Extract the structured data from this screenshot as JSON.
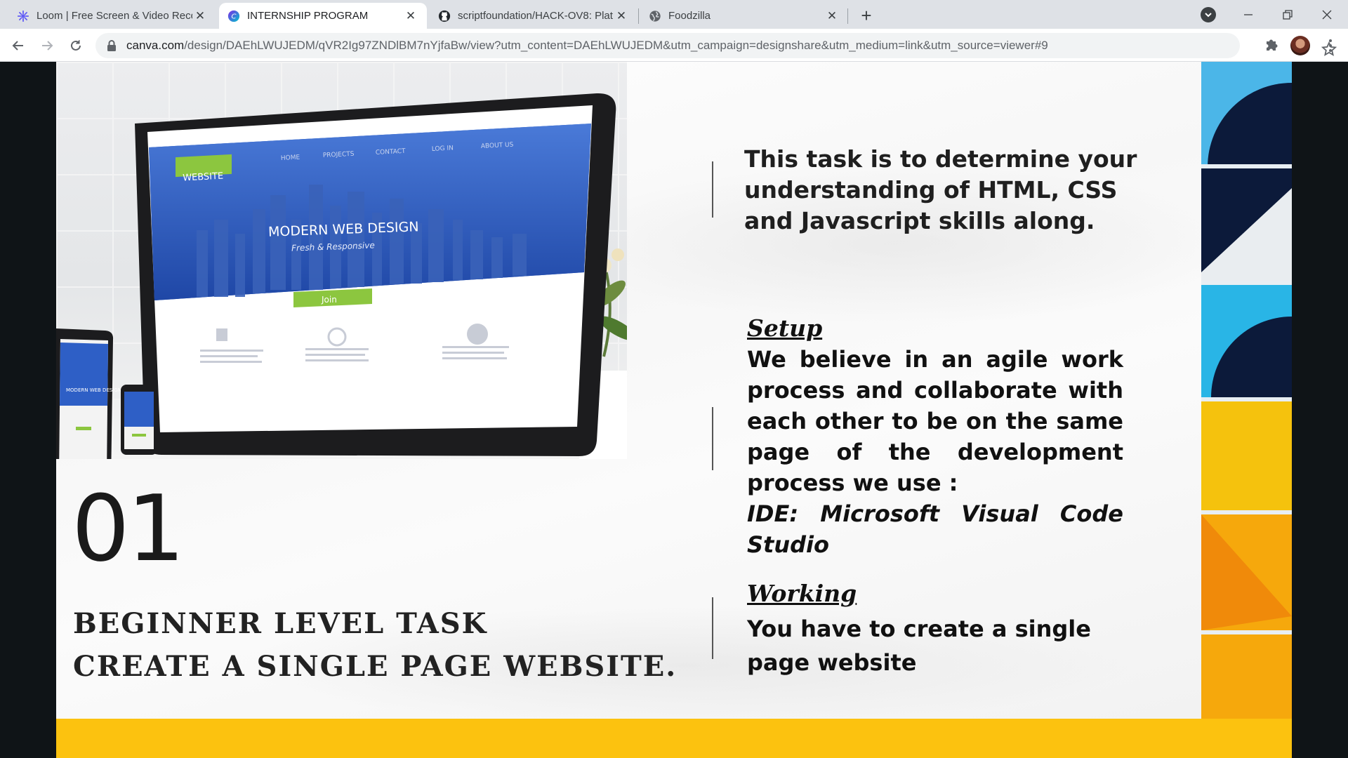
{
  "browser": {
    "tabs": [
      {
        "title": "Loom | Free Screen & Video Reco",
        "icon": "loom-icon",
        "active": false
      },
      {
        "title": "INTERNSHIP PROGRAM",
        "icon": "canva-icon",
        "active": true
      },
      {
        "title": "scriptfoundation/HACK-OV8: Plat",
        "icon": "github-icon",
        "active": false
      },
      {
        "title": "Foodzilla",
        "icon": "globe-icon",
        "active": false
      }
    ],
    "url_host": "canva.com",
    "url_path": "/design/DAEhLWUJEDM/qVR2Ig97ZNDlBM7nYjfaBw/view?utm_content=DAEhLWUJEDM&utm_campaign=designshare&utm_medium=link&utm_source=viewer#9"
  },
  "slide": {
    "hero": {
      "website_tag": "WEBSITE",
      "nav": [
        "HOME",
        "PROJECTS",
        "CONTACT",
        "LOG IN",
        "ABOUT US"
      ],
      "headline": "MODERN WEB DESIGN",
      "subheadline": "Fresh & Responsive",
      "join": "Join",
      "tablet_headline": "MODERN WEB DESIGN"
    },
    "intro": "This task is to determine your understanding  of HTML, CSS and Javascript skills along.",
    "setup": {
      "heading": "Setup",
      "body": "We believe in an agile work process and collaborate with each other to be on the same page of the development process we use :",
      "ide": "IDE: Microsoft Visual Code Studio"
    },
    "working": {
      "heading": "Working",
      "body": "You have to create a single page website"
    },
    "number": "01",
    "level_line1": "BEGINNER LEVEL TASK",
    "level_line2": "CREATE A SINGLE PAGE WEBSITE."
  },
  "colors": {
    "accent_yellow": "#fcc20f",
    "hero_blue": "#2e5fc6",
    "hero_green": "#8cc63f"
  }
}
